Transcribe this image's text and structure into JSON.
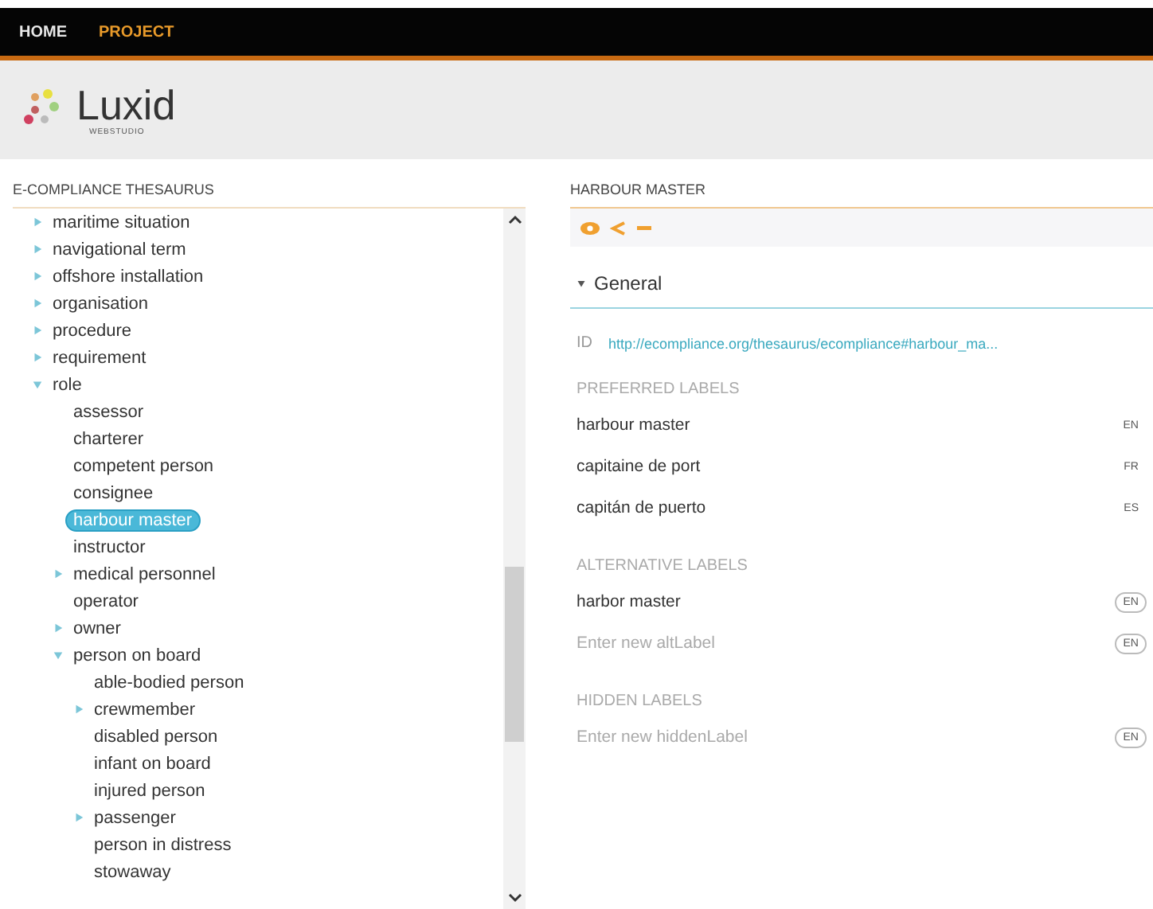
{
  "nav": {
    "items": [
      {
        "label": "HOME",
        "selected": false
      },
      {
        "label": "PROJECT",
        "selected": true
      }
    ]
  },
  "logo": {
    "name": "Luxid",
    "subtitle": "WEBSTUDIO"
  },
  "tree_panel": {
    "title": "E-COMPLIANCE THESAURUS",
    "items": [
      {
        "label": "maritime situation",
        "kind": "collapsed",
        "selected": false
      },
      {
        "label": "navigational term",
        "kind": "collapsed",
        "selected": false
      },
      {
        "label": "offshore installation",
        "kind": "collapsed",
        "selected": false
      },
      {
        "label": "organisation",
        "kind": "collapsed",
        "selected": false
      },
      {
        "label": "procedure",
        "kind": "collapsed",
        "selected": false
      },
      {
        "label": "requirement",
        "kind": "collapsed",
        "selected": false
      },
      {
        "label": "role",
        "kind": "expanded",
        "selected": false,
        "children": [
          {
            "label": "assessor",
            "kind": "leaf",
            "selected": false
          },
          {
            "label": "charterer",
            "kind": "leaf",
            "selected": false
          },
          {
            "label": "competent person",
            "kind": "leaf",
            "selected": false
          },
          {
            "label": "consignee",
            "kind": "leaf",
            "selected": false
          },
          {
            "label": "harbour master",
            "kind": "leaf",
            "selected": true
          },
          {
            "label": "instructor",
            "kind": "leaf",
            "selected": false
          },
          {
            "label": "medical personnel",
            "kind": "collapsed",
            "selected": false
          },
          {
            "label": "operator",
            "kind": "leaf",
            "selected": false
          },
          {
            "label": "owner",
            "kind": "collapsed",
            "selected": false
          },
          {
            "label": "person on board",
            "kind": "expanded",
            "selected": false,
            "children": [
              {
                "label": "able-bodied person",
                "kind": "leaf",
                "selected": false
              },
              {
                "label": "crewmember",
                "kind": "collapsed",
                "selected": false
              },
              {
                "label": "disabled person",
                "kind": "leaf",
                "selected": false
              },
              {
                "label": "infant on board",
                "kind": "leaf",
                "selected": false
              },
              {
                "label": "injured person",
                "kind": "leaf",
                "selected": false
              },
              {
                "label": "passenger",
                "kind": "collapsed",
                "selected": false
              },
              {
                "label": "person in distress",
                "kind": "leaf",
                "selected": false
              },
              {
                "label": "stowaway",
                "kind": "leaf",
                "selected": false
              }
            ]
          }
        ]
      }
    ]
  },
  "detail_panel": {
    "title": "HARBOUR MASTER",
    "section": {
      "label": "General",
      "expanded": true
    },
    "id": {
      "label": "ID",
      "value": "http://ecompliance.org/thesaurus/ecompliance#harbour_ma..."
    },
    "groups": [
      {
        "title": "PREFERRED LABELS",
        "rows": [
          {
            "kind": "value",
            "text": "harbour master",
            "lang": "EN",
            "framed": false
          },
          {
            "kind": "value",
            "text": "capitaine de port",
            "lang": "FR",
            "framed": false
          },
          {
            "kind": "value",
            "text": "capitán de puerto",
            "lang": "ES",
            "framed": false
          }
        ]
      },
      {
        "title": "ALTERNATIVE LABELS",
        "rows": [
          {
            "kind": "value",
            "text": "harbor master",
            "lang": "EN",
            "framed": true
          },
          {
            "kind": "input",
            "placeholder": "Enter new altLabel",
            "lang": "EN",
            "framed": true
          }
        ]
      },
      {
        "title": "HIDDEN LABELS",
        "rows": [
          {
            "kind": "input",
            "placeholder": "Enter new hiddenLabel",
            "lang": "EN",
            "framed": true
          }
        ]
      }
    ]
  }
}
